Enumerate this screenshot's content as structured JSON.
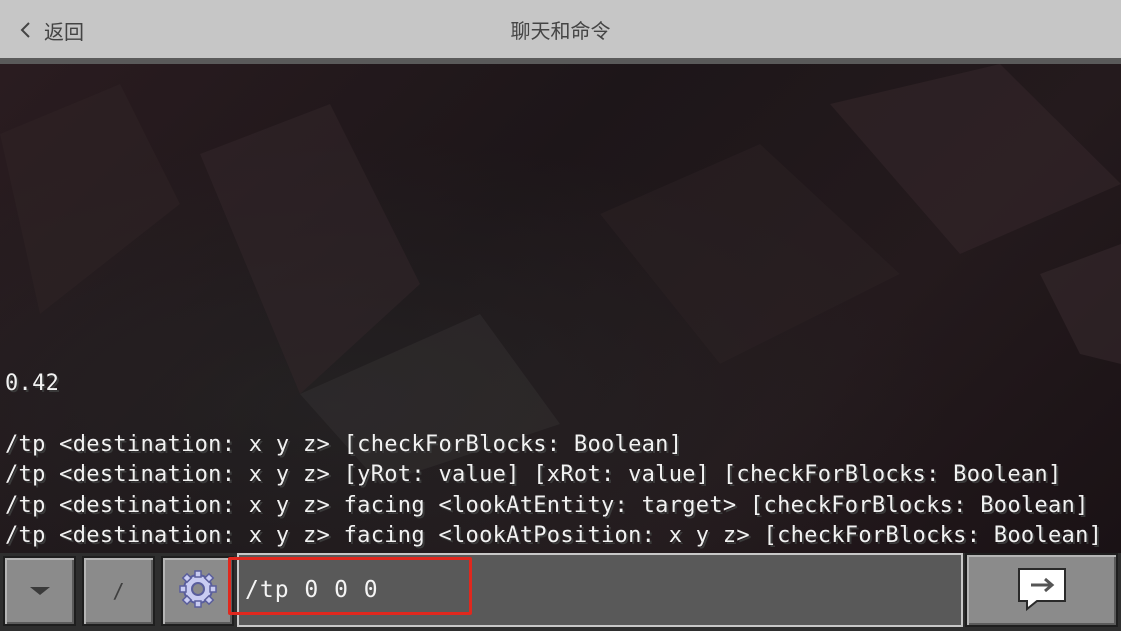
{
  "header": {
    "back_label": "返回",
    "title": "聊天和命令",
    "back_icon": "chevron-left-icon"
  },
  "chat": {
    "lines": [
      "0.42",
      "/tp <destination: x y z> [checkForBlocks: Boolean]",
      "/tp <destination: x y z> [yRot: value] [xRot: value] [checkForBlocks: Boolean]",
      "/tp <destination: x y z> facing <lookAtEntity: target> [checkForBlocks: Boolean]",
      "/tp <destination: x y z> facing <lookAtPosition: x y z> [checkForBlocks: Boolean]"
    ]
  },
  "toolbar": {
    "dropdown_icon": "triangle-down-icon",
    "slash_label": "/",
    "settings_icon": "gear-icon",
    "input_value": "/tp 0 0 0",
    "send_icon": "arrow-right-icon"
  },
  "colors": {
    "highlight": "#e0281e",
    "button_face": "#8b8b8b",
    "titlebar": "#c6c6c6"
  }
}
